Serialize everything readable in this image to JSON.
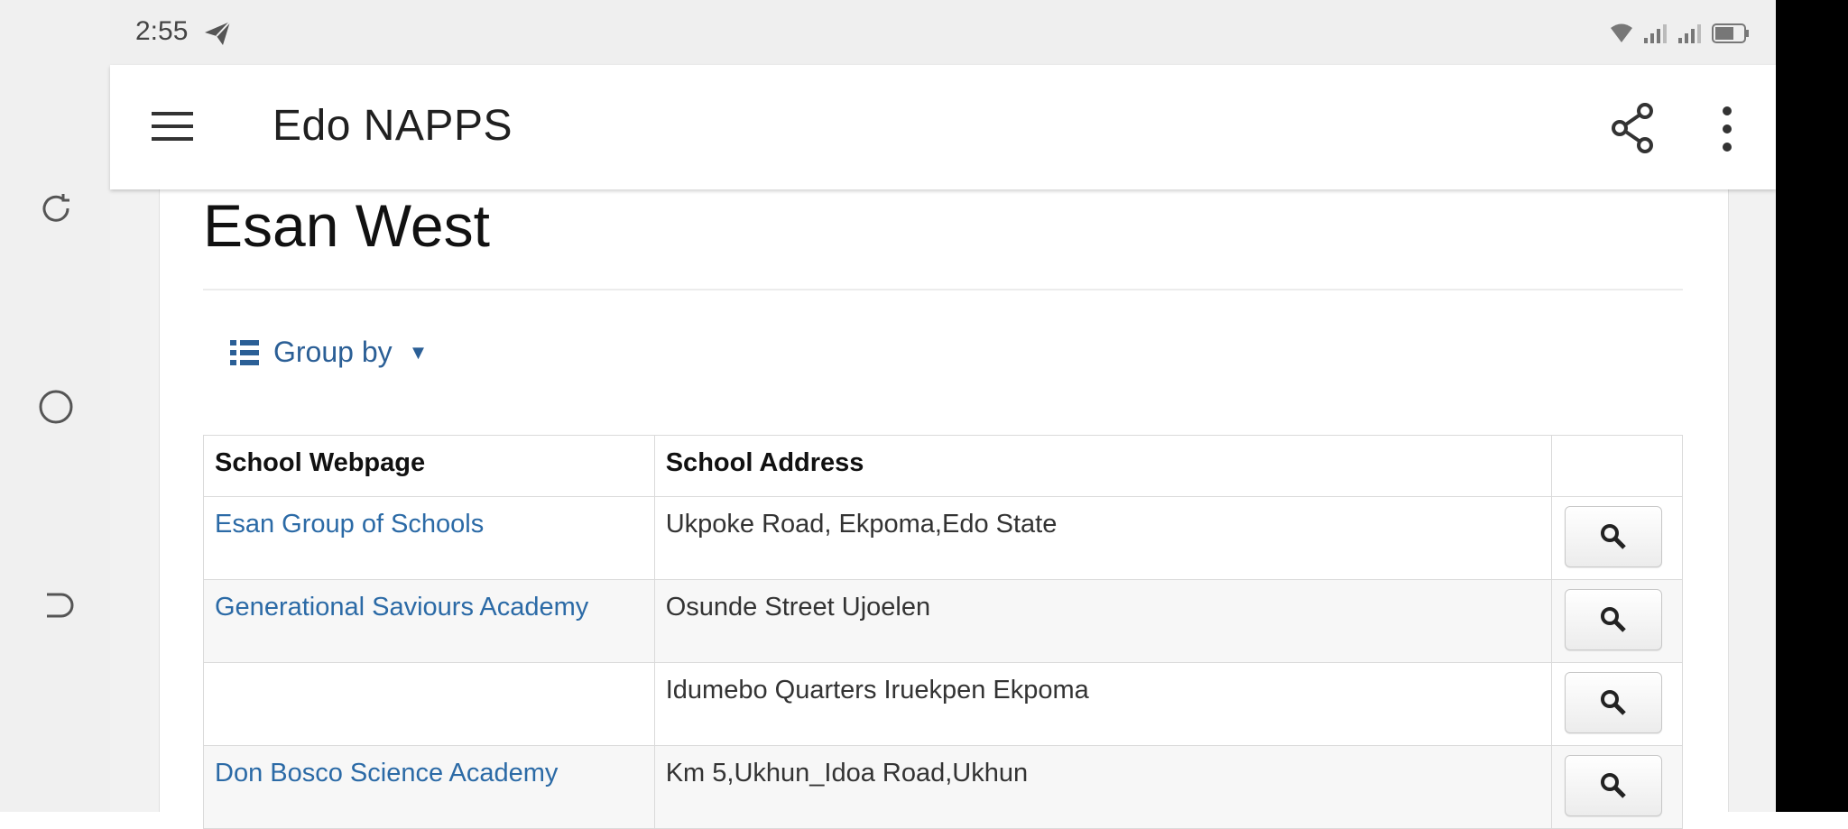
{
  "status_bar": {
    "time": "2:55",
    "icons": [
      "send-icon",
      "wifi-icon",
      "signal-icon",
      "signal-icon",
      "battery-icon"
    ]
  },
  "app_bar": {
    "title": "Edo NAPPS",
    "icons": [
      "menu-icon",
      "share-icon",
      "more-vert-icon"
    ]
  },
  "page": {
    "title": "Esan West",
    "group_by_label": "Group by"
  },
  "table": {
    "headers": [
      "School Webpage",
      "School Address",
      ""
    ],
    "rows": [
      {
        "name": "Esan Group of Schools",
        "address": "Ukpoke Road, Ekpoma,Edo State"
      },
      {
        "name": "Generational Saviours Academy",
        "address": "Osunde Street Ujoelen"
      },
      {
        "name": "",
        "address": "Idumebo Quarters Iruekpen Ekpoma"
      },
      {
        "name": "Don Bosco Science Academy",
        "address": "Km 5,Ukhun_Idoa Road,Ukhun"
      }
    ]
  },
  "colors": {
    "link": "#2b6aa6",
    "app_bar_bg": "#ffffff",
    "status_bar_bg": "#efefef"
  }
}
